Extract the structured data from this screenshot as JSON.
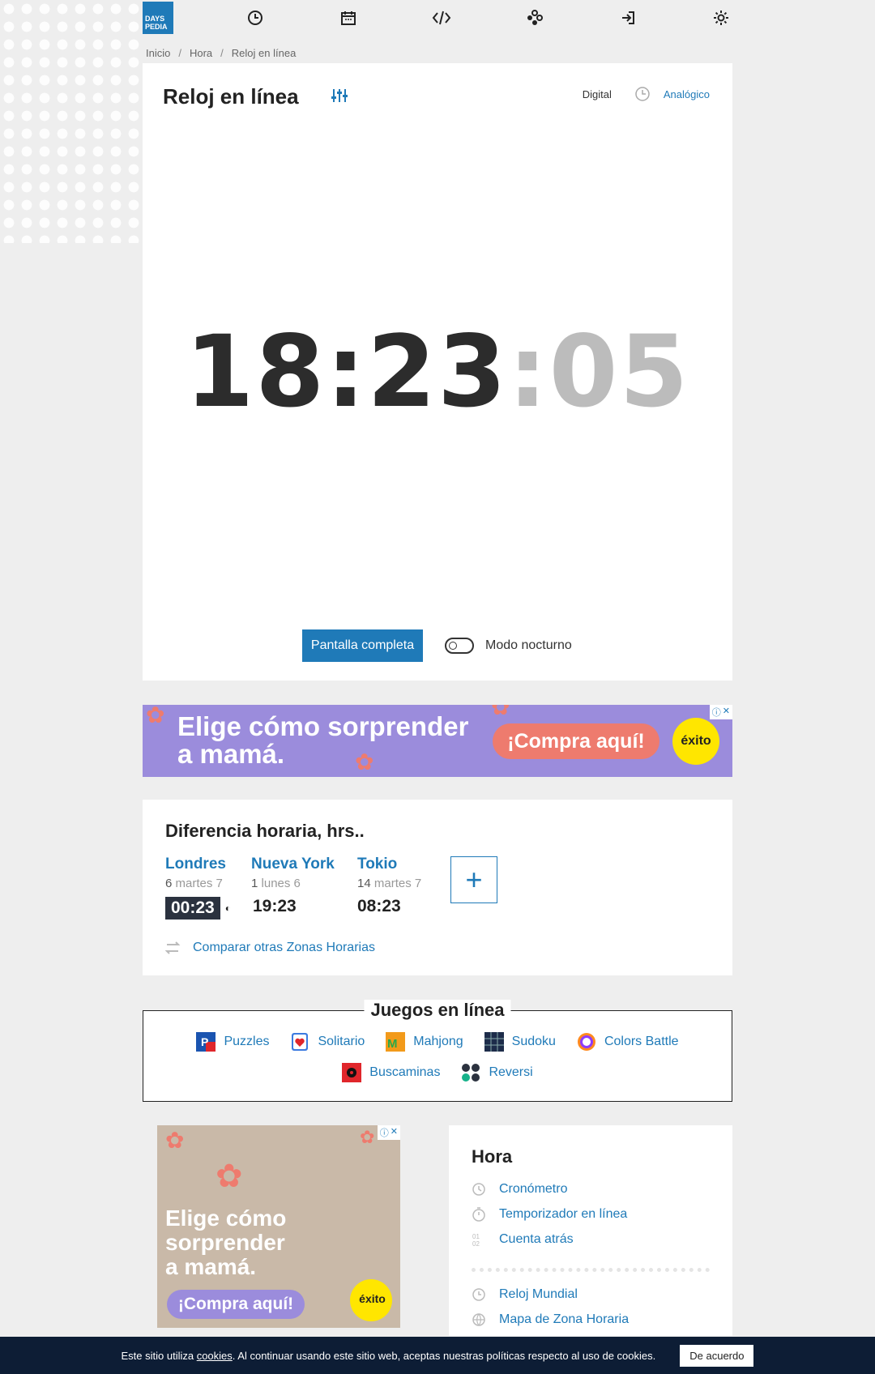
{
  "header": {
    "logo_line1": "DAYS",
    "logo_line2": "PEDIA",
    "nav_icons": [
      "clock-icon",
      "calendar-icon",
      "code-icon",
      "games-icon",
      "login-icon",
      "gear-icon"
    ]
  },
  "breadcrumb": {
    "items": [
      "Inicio",
      "Hora",
      "Reloj en línea"
    ]
  },
  "clock": {
    "title": "Reloj en línea",
    "mode_digital": "Digital",
    "mode_analog": "Analógico",
    "time_hm": "18:23",
    "time_colon": ":",
    "time_s": "05",
    "fullscreen_label": "Pantalla completa",
    "night_mode_label": "Modo nocturno"
  },
  "ad_banner": {
    "headline_line1": "Elige cómo sorprender",
    "headline_line2": "a mamá.",
    "cta": "¡Compra aquí!",
    "brand": "éxito"
  },
  "time_difference": {
    "title": "Diferencia horaria, hrs..",
    "cities": [
      {
        "name": "Londres",
        "offset": "6",
        "day": "martes 7",
        "time": "00:23"
      },
      {
        "name": "Nueva York",
        "offset": "1",
        "day": "lunes 6",
        "time": "19:23"
      },
      {
        "name": "Tokio",
        "offset": "14",
        "day": "martes 7",
        "time": "08:23"
      }
    ],
    "add_label": "+",
    "compare_label": "Comparar otras Zonas Horarias"
  },
  "games": {
    "title": "Juegos en línea",
    "row1": [
      "Puzzles",
      "Solitario",
      "Mahjong",
      "Sudoku",
      "Colors Battle"
    ],
    "row2": [
      "Buscaminas",
      "Reversi"
    ]
  },
  "ad_box": {
    "headline_line1": "Elige cómo",
    "headline_line2": "sorprender",
    "headline_line3": "a mamá.",
    "cta": "¡Compra aquí!",
    "brand": "éxito"
  },
  "side_menu": {
    "title": "Hora",
    "links_top": [
      "Cronómetro",
      "Temporizador en línea",
      "Cuenta atrás"
    ],
    "links_bottom": [
      "Reloj Mundial",
      "Mapa de Zona Horaria"
    ]
  },
  "cookie": {
    "text_before": "Este sitio utiliza ",
    "link": "cookies",
    "text_after": ". Al continuar usando este sitio web, aceptas nuestras políticas respecto al uso de cookies.",
    "button": "De acuerdo"
  },
  "colors": {
    "accent": "#1f7ab8",
    "ad_purple": "#9b8cdc",
    "ad_coral": "#ee7b6e",
    "cookie_bg": "#0d1d35"
  }
}
